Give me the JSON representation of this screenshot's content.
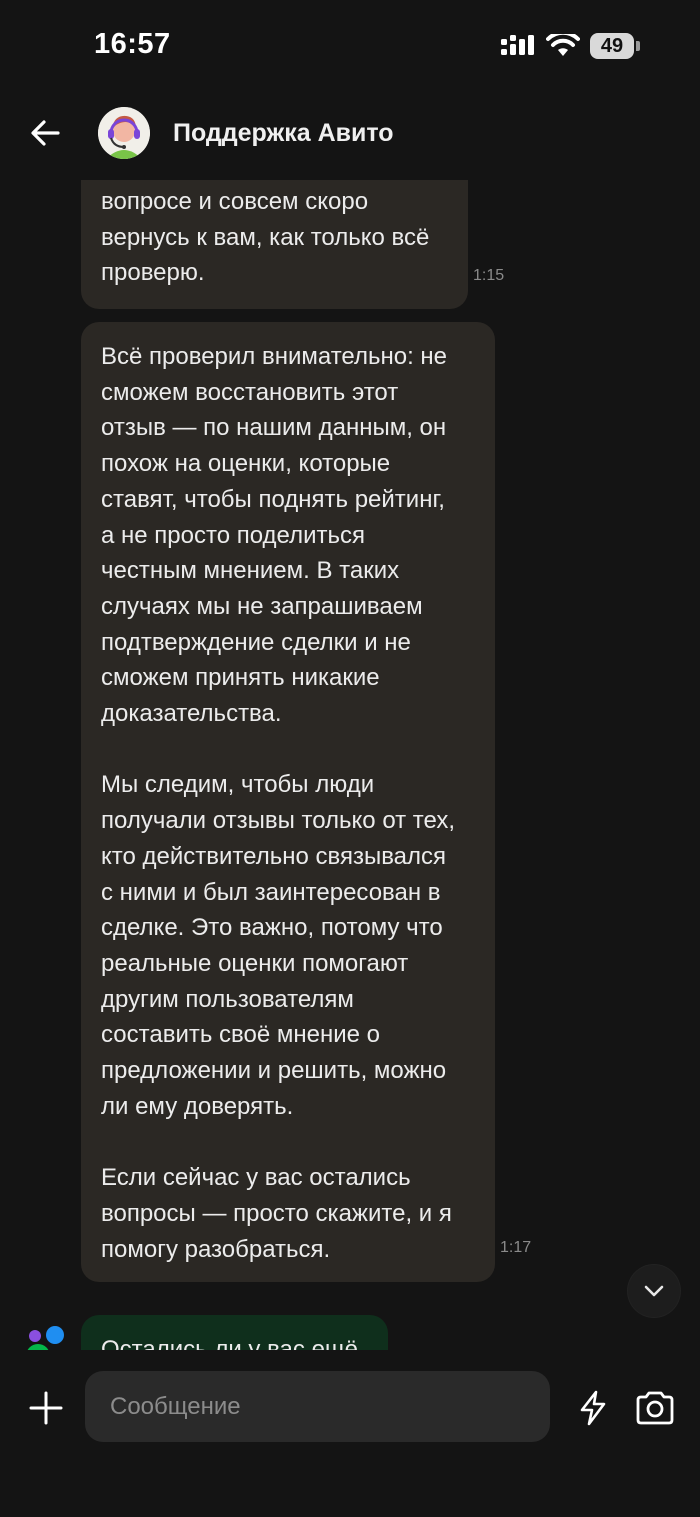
{
  "status_bar": {
    "time": "16:57",
    "battery": "49"
  },
  "header": {
    "title": "Поддержка Авито",
    "back_icon": "arrow-left-icon"
  },
  "messages": [
    {
      "text": "вопросе и совсем скоро\nвернусь к вам, как только всё\nпроверю.",
      "time": "1:15"
    },
    {
      "text": "Всё проверил внимательно: не\nсможем восстановить этот\nотзыв — по нашим данным, он\nпохож на оценки, которые\nставят, чтобы поднять рейтинг,\nа не просто поделиться\nчестным мнением. В таких\nслучаях мы не запрашиваем\nподтверждение сделки и не\nсможем принять никакие\nдоказательства.\n\nМы следим, чтобы люди\nполучали отзывы только от тех,\nкто действительно связывался\nс ними и был заинтересован в\nсделке. Это важно, потому что\nреальные оценки помогают\nдругим пользователям\nсоставить своё мнение о\nпредложении и решить, можно\nли ему доверять.\n\nЕсли сейчас у вас остались\nвопросы — просто скажите, и я\nпомогу разобраться.",
      "time": "1:17"
    },
    {
      "text": "Остались ли у вас ещё"
    }
  ],
  "input": {
    "placeholder": "Сообщение"
  },
  "colors": {
    "background": "#141414",
    "bubble": "#2b2824",
    "bot_bubble": "#0f2f1c"
  }
}
